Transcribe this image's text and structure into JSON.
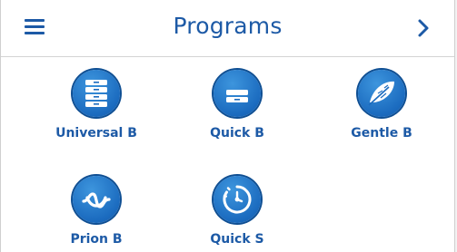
{
  "header": {
    "title": "Programs",
    "menu_icon": "hamburger-menu-icon",
    "next_icon": "chevron-right-icon"
  },
  "programs": [
    {
      "label": "Universal B",
      "icon": "stacked-trays-icon"
    },
    {
      "label": "Quick B",
      "icon": "single-tray-icon"
    },
    {
      "label": "Gentle B",
      "icon": "feather-icon"
    },
    {
      "label": "Prion B",
      "icon": "prion-wave-icon"
    },
    {
      "label": "Quick S",
      "icon": "stopwatch-icon"
    }
  ],
  "colors": {
    "accent": "#1d5aa6",
    "icon_bg": "#1b6bbf",
    "background": "#ffffff",
    "divider": "#d4d4d4"
  }
}
